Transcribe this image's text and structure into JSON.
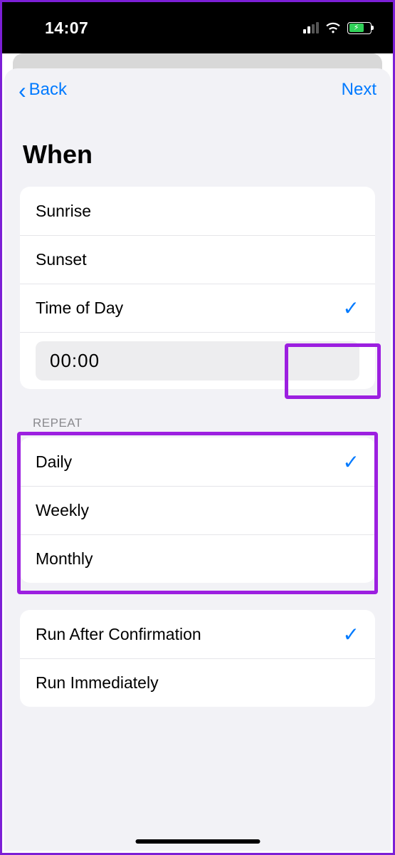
{
  "statusbar": {
    "time": "14:07"
  },
  "nav": {
    "back": "Back",
    "next": "Next"
  },
  "title": "When",
  "when_group": {
    "sunrise": "Sunrise",
    "sunset": "Sunset",
    "time_of_day": "Time of Day",
    "time_value": "00:00"
  },
  "repeat": {
    "header": "Repeat",
    "daily": "Daily",
    "weekly": "Weekly",
    "monthly": "Monthly"
  },
  "run": {
    "after_confirm": "Run After Confirmation",
    "immediately": "Run Immediately"
  }
}
